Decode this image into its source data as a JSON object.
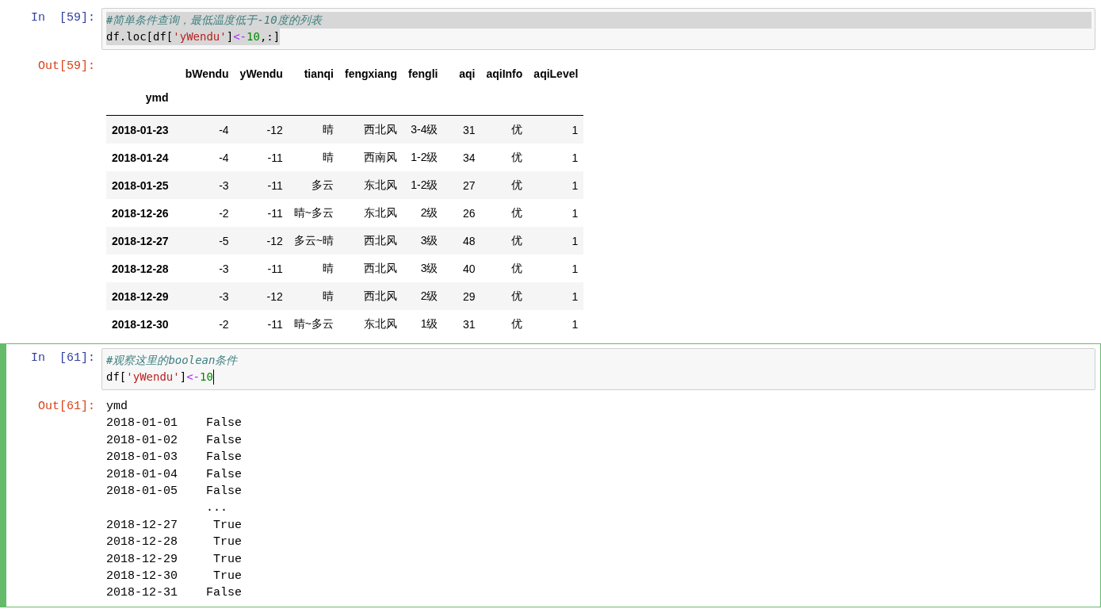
{
  "cells": [
    {
      "selected": false,
      "input_prompt": "In  [59]:",
      "code": [
        {
          "highlighted": true,
          "cursor": false,
          "tokens": [
            {
              "kind": "comment",
              "text": "#简单条件查询，最低温度低于-10度的列表"
            }
          ]
        },
        {
          "highlighted": true,
          "cursor": false,
          "tokens": [
            {
              "kind": "plain",
              "text": "df.loc[df["
            },
            {
              "kind": "string",
              "text": "'yWendu'"
            },
            {
              "kind": "plain",
              "text": "]"
            },
            {
              "kind": "operator",
              "text": "<-"
            },
            {
              "kind": "number",
              "text": "10"
            },
            {
              "kind": "plain",
              "text": ",:]"
            }
          ]
        }
      ],
      "output_prompt": "Out[59]:",
      "output": {
        "kind": "table",
        "columns": [
          "",
          "bWendu",
          "yWendu",
          "tianqi",
          "fengxiang",
          "fengli",
          "aqi",
          "aqiInfo",
          "aqiLevel"
        ],
        "index_name": "ymd",
        "rows": [
          [
            "2018-01-23",
            "-4",
            "-12",
            "晴",
            "西北风",
            "3-4级",
            "31",
            "优",
            "1"
          ],
          [
            "2018-01-24",
            "-4",
            "-11",
            "晴",
            "西南风",
            "1-2级",
            "34",
            "优",
            "1"
          ],
          [
            "2018-01-25",
            "-3",
            "-11",
            "多云",
            "东北风",
            "1-2级",
            "27",
            "优",
            "1"
          ],
          [
            "2018-12-26",
            "-2",
            "-11",
            "晴~多云",
            "东北风",
            "2级",
            "26",
            "优",
            "1"
          ],
          [
            "2018-12-27",
            "-5",
            "-12",
            "多云~晴",
            "西北风",
            "3级",
            "48",
            "优",
            "1"
          ],
          [
            "2018-12-28",
            "-3",
            "-11",
            "晴",
            "西北风",
            "3级",
            "40",
            "优",
            "1"
          ],
          [
            "2018-12-29",
            "-3",
            "-12",
            "晴",
            "西北风",
            "2级",
            "29",
            "优",
            "1"
          ],
          [
            "2018-12-30",
            "-2",
            "-11",
            "晴~多云",
            "东北风",
            "1级",
            "31",
            "优",
            "1"
          ]
        ]
      }
    },
    {
      "selected": true,
      "input_prompt": "In  [61]:",
      "code": [
        {
          "highlighted": false,
          "cursor": false,
          "tokens": [
            {
              "kind": "comment",
              "text": "#观察这里的boolean条件"
            }
          ]
        },
        {
          "highlighted": false,
          "cursor": true,
          "tokens": [
            {
              "kind": "plain",
              "text": "df["
            },
            {
              "kind": "string",
              "text": "'yWendu'"
            },
            {
              "kind": "plain",
              "text": "]"
            },
            {
              "kind": "operator",
              "text": "<-"
            },
            {
              "kind": "number",
              "text": "10"
            }
          ]
        }
      ],
      "output_prompt": "Out[61]:",
      "output": {
        "kind": "text",
        "lines": [
          "ymd",
          "2018-01-01    False",
          "2018-01-02    False",
          "2018-01-03    False",
          "2018-01-04    False",
          "2018-01-05    False",
          "              ...",
          "2018-12-27     True",
          "2018-12-28     True",
          "2018-12-29     True",
          "2018-12-30     True",
          "2018-12-31    False"
        ]
      }
    }
  ]
}
